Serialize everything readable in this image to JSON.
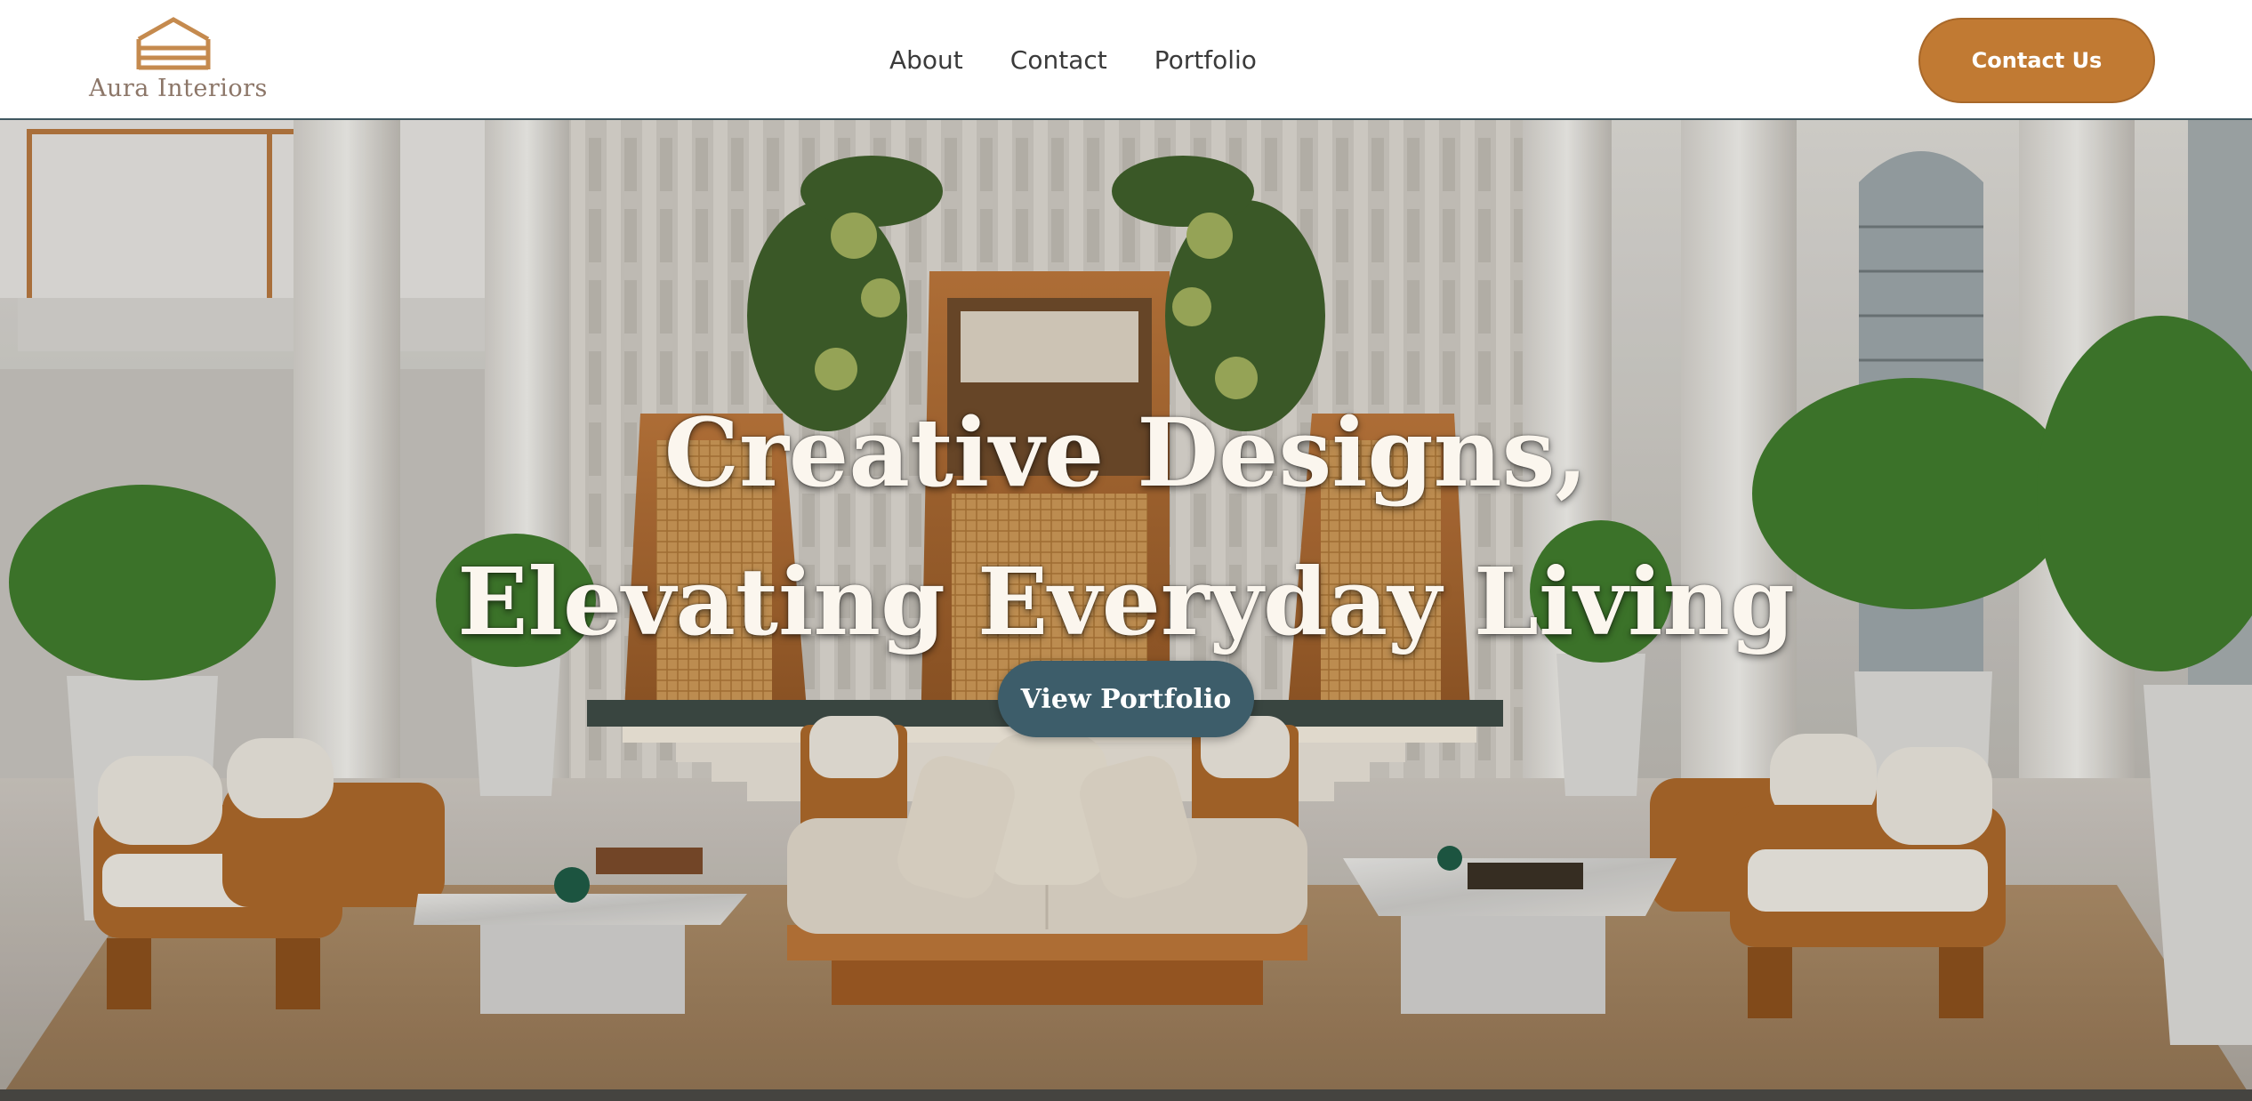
{
  "brand": {
    "name": "Aura Interiors",
    "icon": "house-roof-icon",
    "color": "#c58a4e"
  },
  "nav": {
    "items": [
      {
        "label": "About"
      },
      {
        "label": "Contact"
      },
      {
        "label": "Portfolio"
      }
    ]
  },
  "header": {
    "cta_label": "Contact Us",
    "cta_color": "#c17a33"
  },
  "hero": {
    "title_line1": "Creative Designs,",
    "title_line2": "Elevating Everyday Living",
    "button_label": "View Portfolio",
    "button_color": "#3d5d6a",
    "background": "interior-lobby-photo"
  }
}
